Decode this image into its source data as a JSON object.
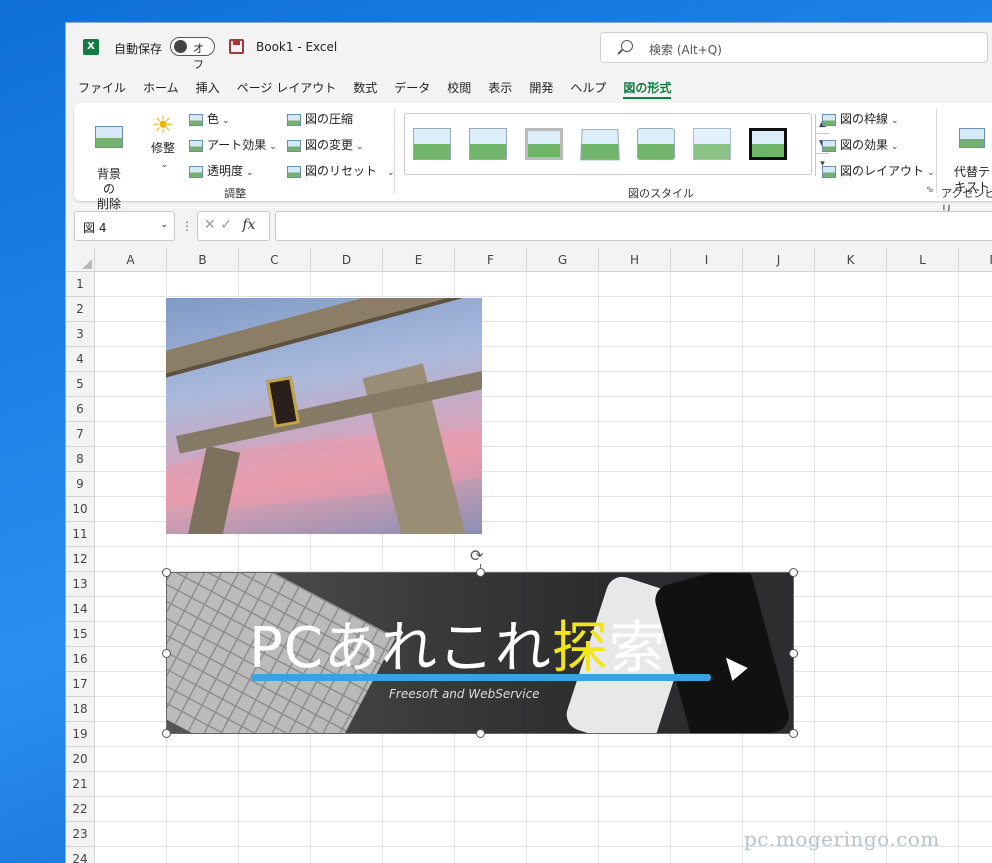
{
  "titlebar": {
    "app_icon": "X",
    "autosave_label": "自動保存",
    "autosave_state": "オフ",
    "document_title": "Book1  -  Excel",
    "search_placeholder": "検索 (Alt+Q)"
  },
  "tabs": [
    "ファイル",
    "ホーム",
    "挿入",
    "ページ レイアウト",
    "数式",
    "データ",
    "校閲",
    "表示",
    "開発",
    "ヘルプ",
    "図の形式"
  ],
  "active_tab": "図の形式",
  "ribbon": {
    "remove_bg": "背景の\n削除",
    "corrections": "修整",
    "color": "色",
    "artistic": "アート効果",
    "transparency": "透明度",
    "compress": "図の圧縮",
    "change": "図の変更",
    "reset": "図のリセット",
    "adjust_group": "調整",
    "styles_group": "図のスタイル",
    "border": "図の枠線",
    "effects": "図の効果",
    "layout": "図のレイアウト",
    "alt_text": "代替テ\nキスト",
    "access_group": "アクセシビリ"
  },
  "formula_bar": {
    "name_box": "図 4",
    "fx": "fx",
    "value": ""
  },
  "columns": [
    "A",
    "B",
    "C",
    "D",
    "E",
    "F",
    "G",
    "H",
    "I",
    "J",
    "K",
    "L",
    "M"
  ],
  "rows": [
    "1",
    "2",
    "3",
    "4",
    "5",
    "6",
    "7",
    "8",
    "9",
    "10",
    "11",
    "12",
    "13",
    "14",
    "15",
    "16",
    "17",
    "18",
    "19",
    "20",
    "21",
    "22",
    "23",
    "24"
  ],
  "banner": {
    "headline_main": "PCあれこれ",
    "headline_hl": "探",
    "headline_end": "索",
    "subtitle": "Freesoft and WebService"
  },
  "watermark": "pc.mogeringo.com",
  "colors": {
    "excel_green": "#107c41",
    "banner_accent": "#f1e51c",
    "underline_blue": "#37a3e0"
  }
}
